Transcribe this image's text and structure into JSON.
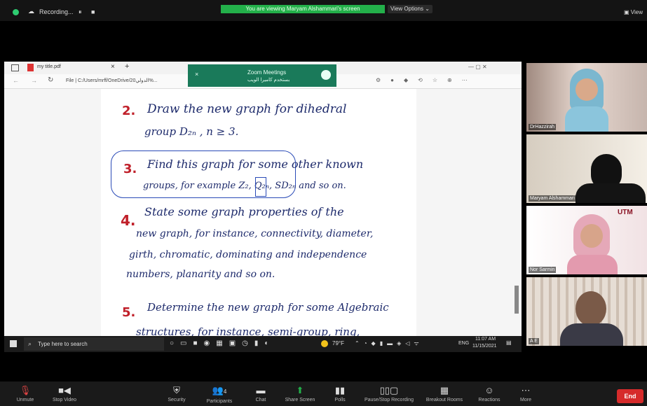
{
  "topbar": {
    "recording_label": "Recording...",
    "pause": "⏸",
    "stop": "■",
    "viewing": "You are viewing Maryam Alshammari's screen",
    "view_options": "View Options ⌄",
    "view": "View"
  },
  "browser": {
    "tab_title": "my title.pdf",
    "tab_close": "×",
    "new_tab": "+",
    "address": "File | C:/Users/mrff/OneDrive/الدولي20%...",
    "window_controls": "—  ▢  ✕"
  },
  "zoom_popup": {
    "title": "Zoom Meetings",
    "subtitle": "بستخدم كاميرا الويب"
  },
  "handwriting": {
    "n2": "2.",
    "l2a": "Draw  the new graph for dihedral",
    "l2b": "group D₂ₙ ,  n ≥ 3.",
    "n3": "3.",
    "l3a": "Find this graph for some other known",
    "l3b": "groups, for example Z₂, Q₂ₙ, SD₂ₙ and so on.",
    "n4": "4.",
    "l4a": "State some graph properties of the",
    "l4b": "new graph, for instance, connectivity, diameter,",
    "l4c": "girth, chromatic, dominating and independence",
    "l4d": "numbers, planarity and so on.",
    "n5": "5.",
    "l5a": "Determine the new graph for some Algebraic",
    "l5b": "structures, for instance, semi-group, ring,"
  },
  "taskbar": {
    "search": "Type here to search",
    "weather": "79°F",
    "lang": "ENG",
    "time": "11:07 AM",
    "date": "11/15/2021"
  },
  "participants": [
    {
      "name": "DrHazzirah"
    },
    {
      "name": "Maryam Alshammari"
    },
    {
      "name": "Nor Sarmin",
      "logo": "UTM"
    },
    {
      "name": "A E"
    }
  ],
  "toolbar": {
    "unmute": "Unmute",
    "stop_video": "Stop Video",
    "security": "Security",
    "participants": "Participants",
    "participants_count": "4",
    "chat": "Chat",
    "share_screen": "Share Screen",
    "polls": "Polls",
    "pause_recording": "Pause/Stop Recording",
    "breakout": "Breakout Rooms",
    "reactions": "Reactions",
    "more": "More",
    "end": "End"
  },
  "colors": {
    "share_green": "#23b04a",
    "end_red": "#d62b2b",
    "ink_blue": "#1d2a6b",
    "ink_red": "#c0202a"
  }
}
